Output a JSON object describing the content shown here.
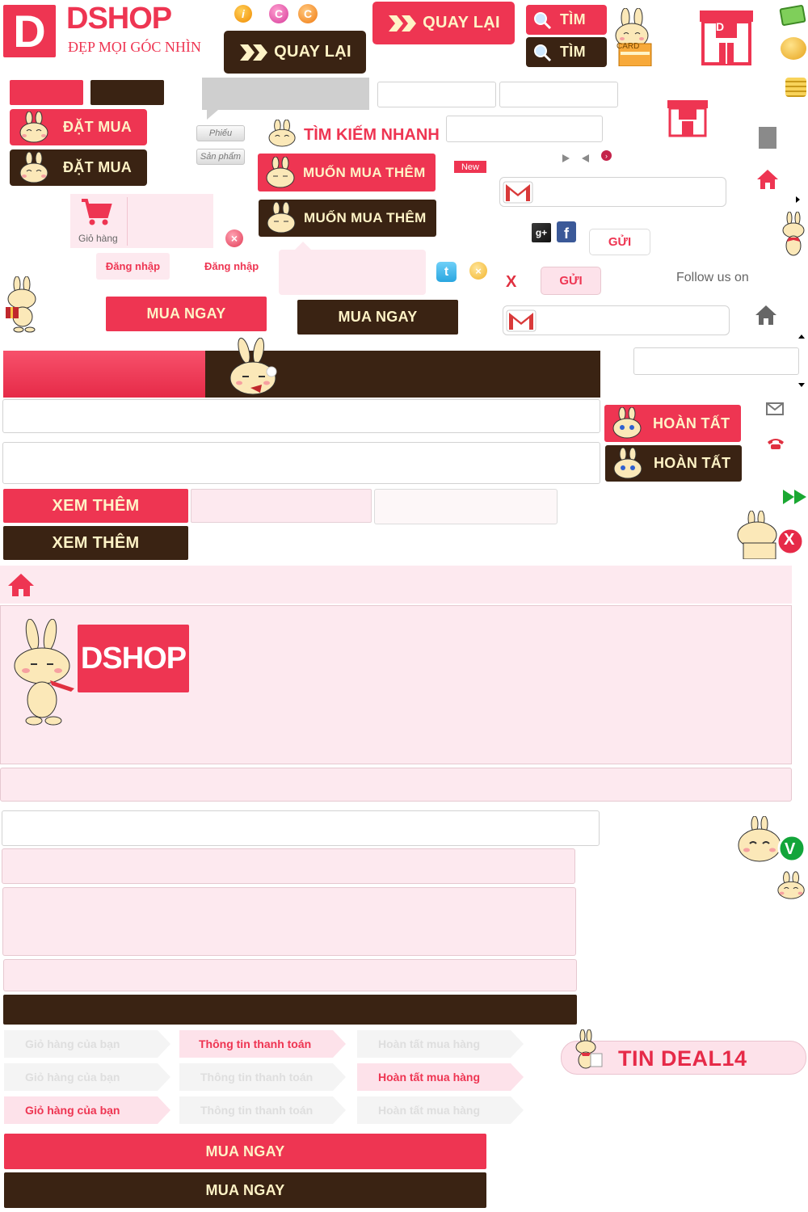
{
  "brand": {
    "name": "DSHOP",
    "tagline": "ĐẸP MỌI GÓC NHÌN",
    "logo_letter": "D",
    "icon_letter": "D",
    "icon_word": "SHOP",
    "colors": {
      "primary": "#ee3552",
      "dark": "#3a2313",
      "light": "#fde9ef",
      "cream": "#fff3c6"
    }
  },
  "buttons": {
    "back_label": "QUAY LẠI",
    "search_label": "TÌM",
    "buy_label": "ĐẶT MUA",
    "quick_search_label": "TÌM KIẾM NHANH",
    "buy_more_label": "MUỐN MUA THÊM",
    "new_badge": "New",
    "send_label": "GỬI",
    "follow_label": "Follow us on",
    "buy_now_label": "MUA NGAY",
    "done_label": "HOÀN TẤT",
    "see_more_label": "XEM THÊM",
    "close_x": "X",
    "check_v": "V"
  },
  "cart": {
    "label": "Giỏ hàng"
  },
  "tabs": {
    "coupon": "Phiếu",
    "product": "Sản phẩm"
  },
  "login": {
    "label_1": "Đăng nhập",
    "label_2": "Đăng nhập"
  },
  "card": {
    "label": "CARD"
  },
  "social": {
    "google": "g+",
    "facebook": "f"
  },
  "steps": {
    "cart": "Giỏ hàng của bạn",
    "payment": "Thông tin thanh toán",
    "complete": "Hoàn tất mua hàng"
  },
  "deal": {
    "label": "TIN DEAL14"
  },
  "icons": [
    "info-icon",
    "refresh-pink-icon",
    "refresh-orange-icon",
    "search-icon",
    "cart-icon",
    "close-circle-icon",
    "gmail-icon",
    "home-icon",
    "twitter-icon",
    "facebook-icon",
    "google-plus-icon",
    "envelope-icon",
    "phone-icon",
    "fast-forward-icon",
    "money-icon",
    "piggy-bank-icon",
    "coins-icon",
    "store-icon"
  ]
}
